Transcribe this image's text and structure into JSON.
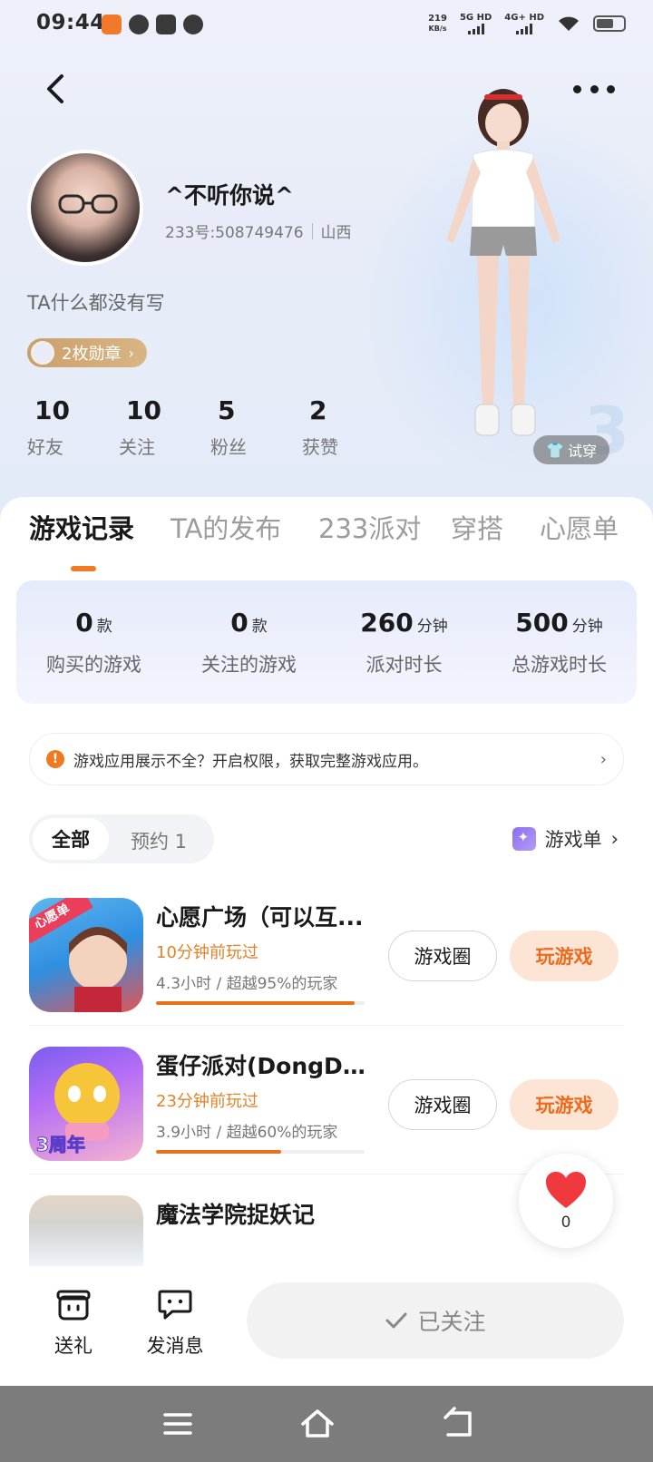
{
  "status_bar": {
    "time": "09:44",
    "speed_value": "219",
    "speed_unit": "KB/s",
    "net1": "5G HD",
    "net2": "4G+ HD"
  },
  "profile": {
    "nickname": "^不听你说^",
    "id_text": "233号:508749476",
    "location": "山西",
    "bio": "TA什么都没有写",
    "medal_label": "2枚勋章",
    "try_on_label": "试穿"
  },
  "stats": [
    {
      "value": "10",
      "label": "好友"
    },
    {
      "value": "10",
      "label": "关注"
    },
    {
      "value": "5",
      "label": "粉丝"
    },
    {
      "value": "2",
      "label": "获赞"
    }
  ],
  "tabs": [
    {
      "label": "游戏记录",
      "active": true
    },
    {
      "label": "TA的发布",
      "active": false
    },
    {
      "label": "233派对",
      "active": false
    },
    {
      "label": "穿搭",
      "active": false
    },
    {
      "label": "心愿单",
      "active": false
    }
  ],
  "summary": [
    {
      "value": "0",
      "unit": "款",
      "label": "购买的游戏"
    },
    {
      "value": "0",
      "unit": "款",
      "label": "关注的游戏"
    },
    {
      "value": "260",
      "unit": "分钟",
      "label": "派对时长"
    },
    {
      "value": "500",
      "unit": "分钟",
      "label": "总游戏时长"
    }
  ],
  "notice": {
    "icon": "!",
    "text": "游戏应用展示不全？开启权限，获取完整游戏应用。"
  },
  "filter": {
    "all_label": "全部",
    "preorder_label": "预约 1",
    "game_list_label": "游戏单"
  },
  "games": [
    {
      "title": "心愿广场（可以互...",
      "recent": "10分钟前玩过",
      "stat": "4.3小时 / 超越95%的玩家",
      "progress": 0.95,
      "icon_text": "心愿单",
      "circle_label": "游戏圈",
      "play_label": "玩游戏"
    },
    {
      "title": "蛋仔派对(DongDo...",
      "recent": "23分钟前玩过",
      "stat": "3.9小时 / 超越60%的玩家",
      "progress": 0.6,
      "icon_text": "3周年",
      "circle_label": "游戏圈",
      "play_label": "玩游戏"
    },
    {
      "title": "魔法学院捉妖记",
      "recent": "",
      "stat": "",
      "progress": 0,
      "icon_text": "",
      "circle_label": "",
      "play_label": ""
    }
  ],
  "like": {
    "count": "0"
  },
  "bottom_bar": {
    "gift_label": "送礼",
    "message_label": "发消息",
    "follow_label": "已关注"
  },
  "colors": {
    "accent": "#f27a22",
    "play_bg": "#fde5d6",
    "medal": "#c9a06b"
  }
}
